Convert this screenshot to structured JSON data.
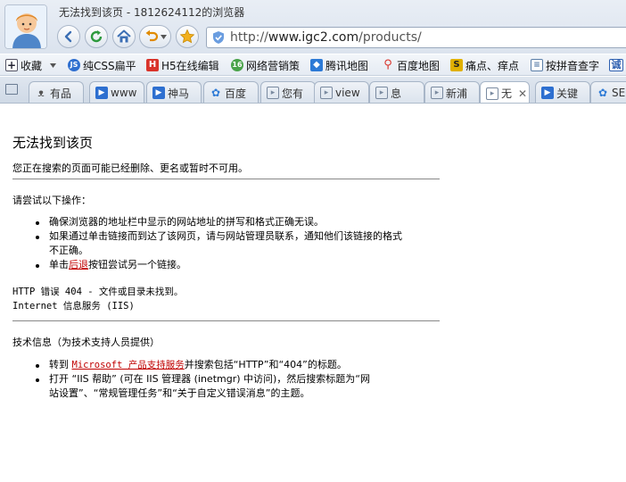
{
  "window": {
    "title": "无法找到该页 - 1812624112的浏览器"
  },
  "address_bar": {
    "url_prefix": "http://",
    "url_host": "www.igc2.com",
    "url_path": "/products/"
  },
  "bookmarks": [
    {
      "label": "收藏",
      "icon": "plus-icon",
      "color": "#3a6fb0"
    },
    {
      "label": "纯CSS扁平",
      "icon": "js-icon",
      "color": "#2f6fd0"
    },
    {
      "label": "H5在线编辑",
      "icon": "h-icon",
      "color": "#d9342b"
    },
    {
      "label": "网络营销策",
      "icon": "circle-icon",
      "color": "#4aa34a"
    },
    {
      "label": "腾讯地图",
      "icon": "map-icon",
      "color": "#2d7ad6"
    },
    {
      "label": "百度地图",
      "icon": "pin-icon",
      "color": "#d9342b"
    },
    {
      "label": "痛点、痒点",
      "icon": "s-icon",
      "color": "#e0b000"
    },
    {
      "label": "按拼音查字",
      "icon": "page-icon",
      "color": "#5a7ea8"
    },
    {
      "label": "诚",
      "icon": "cheng-icon",
      "color": "#2d5fb0"
    }
  ],
  "tabs": [
    {
      "label": "有品",
      "icon": "cat-icon",
      "color": "#555555",
      "active": false
    },
    {
      "label": "www",
      "icon": "flag-icon",
      "color": "#2d6fd0",
      "active": false
    },
    {
      "label": "神马",
      "icon": "flag-icon",
      "color": "#2d6fd0",
      "active": false
    },
    {
      "label": "百度",
      "icon": "paw-icon",
      "color": "#2d7ad6",
      "active": false
    },
    {
      "label": "您有",
      "icon": "page-icon",
      "color": "#7a8aa0",
      "active": false
    },
    {
      "label": "view",
      "icon": "page-icon",
      "color": "#7a8aa0",
      "active": false
    },
    {
      "label": "息",
      "icon": "page-icon",
      "color": "#7a8aa0",
      "active": false
    },
    {
      "label": "新浦",
      "icon": "page-icon",
      "color": "#7a8aa0",
      "active": false
    },
    {
      "label": "无",
      "icon": "page-icon",
      "color": "#7a8aa0",
      "active": true
    },
    {
      "label": "关键",
      "icon": "flag-icon",
      "color": "#2d6fd0",
      "active": false
    },
    {
      "label": "SEO",
      "icon": "paw-icon",
      "color": "#2d7ad6",
      "active": false
    }
  ],
  "error_page": {
    "title": "无法找到该页",
    "subtitle": "您正在搜索的页面可能已经删除、更名或暂时不可用。",
    "try_heading": "请尝试以下操作：",
    "try_items": {
      "item1": "确保浏览器的地址栏中显示的网站地址的拼写和格式正确无误。",
      "item2_line1": "如果通过单击链接而到达了该网页，请与网站管理员联系，通知他们该链接的格式",
      "item2_line2": "不正确。",
      "item3_pre": "单击",
      "item3_link": "后退",
      "item3_post": "按钮尝试另一个链接。"
    },
    "http_error": "HTTP 错误 404 - 文件或目录未找到。",
    "iis": "Internet 信息服务 (IIS)",
    "tech_heading": "技术信息（为技术支持人员提供）",
    "tech_items": {
      "item1_pre": "转到 ",
      "item1_link": "Microsoft 产品支持服务",
      "item1_post": "并搜索包括“HTTP”和“404”的标题。",
      "item2_line1": "打开 “IIS 帮助” (可在 IIS 管理器 (inetmgr) 中访问)，然后搜索标题为“网",
      "item2_line2": "站设置”、“常规管理任务”和“关于自定义错误消息”的主题。"
    },
    "link_color": "#c00000"
  }
}
